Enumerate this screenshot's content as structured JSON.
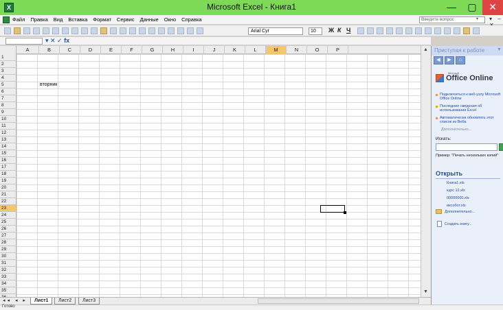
{
  "window": {
    "title": "Microsoft Excel - Книга1",
    "app_icon": "X",
    "minimize": "—",
    "maximize": "▢",
    "close": "✕"
  },
  "menu": {
    "items": [
      "Файл",
      "Правка",
      "Вид",
      "Вставка",
      "Формат",
      "Сервис",
      "Данные",
      "Окно",
      "Справка"
    ],
    "ask_placeholder": "Введите вопрос",
    "doc_controls": "▾ – ✕"
  },
  "toolbar": {
    "font": "Arial Cyr",
    "size": "10",
    "bold": "Ж",
    "italic": "К",
    "underline": "Ч"
  },
  "formula": {
    "controls": "▾ ✕ ✓ fx"
  },
  "grid": {
    "columns": [
      "A",
      "B",
      "C",
      "D",
      "E",
      "F",
      "G",
      "H",
      "I",
      "J",
      "K",
      "L",
      "M",
      "N",
      "O",
      "P"
    ],
    "rows": [
      "1",
      "2",
      "3",
      "4",
      "5",
      "6",
      "7",
      "8",
      "9",
      "10",
      "11",
      "12",
      "13",
      "14",
      "15",
      "16",
      "17",
      "18",
      "19",
      "20",
      "21",
      "22",
      "23",
      "24",
      "25",
      "26",
      "27",
      "28",
      "29",
      "30",
      "31",
      "32",
      "33",
      "34",
      "35",
      "36"
    ],
    "selected_column": "M",
    "selected_row": "23",
    "cell_B5": "вторник"
  },
  "sheets": {
    "nav": "◂◂ ◂ ▸ ▸▸",
    "tabs": [
      "Лист1",
      "Лист2",
      "Лист3"
    ],
    "active": "Лист1"
  },
  "status": {
    "text": "Готово"
  },
  "taskpane": {
    "title": "Приступая к работе",
    "nav_back": "◀",
    "nav_fwd": "▶",
    "nav_home": "⌂",
    "office_brand": "Office Online",
    "office_sup": "Microsoft",
    "links": [
      "Подключиться к веб-узлу Microsoft Office Online",
      "Последние сведения об использовании Excel",
      "Автоматически обновлять этот список из Веба"
    ],
    "more": "Дополнительно...",
    "search_label": "Искать:",
    "example": "Пример: \"Печать нескольких копий\"",
    "open_header": "Открыть",
    "files": [
      "Книга1.xls",
      "курс 12.xls",
      "00000000.xls",
      "иксобот.xls"
    ],
    "open_more": "Дополнительно...",
    "create": "Создать книгу..."
  }
}
